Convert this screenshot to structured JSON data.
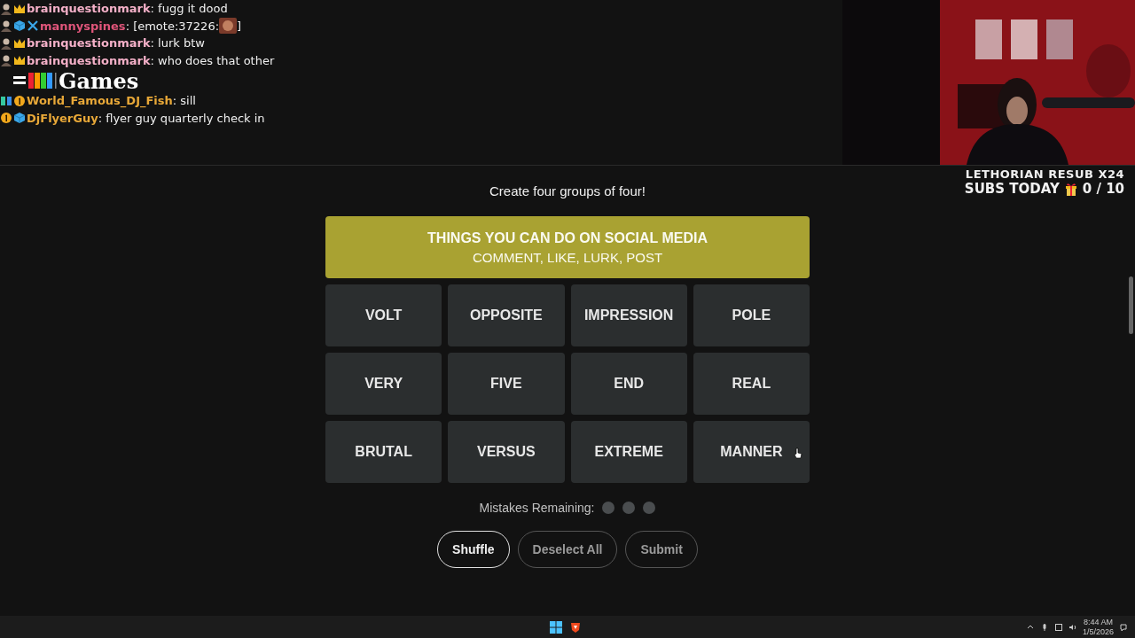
{
  "chat": [
    {
      "badges": [
        {
          "kind": "avatar"
        },
        {
          "kind": "crown"
        }
      ],
      "name": "brainquestionmark",
      "color": "#f4b0c8",
      "message": ": fugg it dood"
    },
    {
      "badges": [
        {
          "kind": "avatar"
        },
        {
          "kind": "cube"
        },
        {
          "kind": "sword"
        }
      ],
      "name": "mannyspines",
      "color": "#e0557a",
      "message": ": [emote:37226:",
      "emote": true,
      "tail": "]"
    },
    {
      "badges": [
        {
          "kind": "avatar"
        },
        {
          "kind": "crown"
        }
      ],
      "name": "brainquestionmark",
      "color": "#f4b0c8",
      "message": ": lurk btw"
    },
    {
      "badges": [
        {
          "kind": "avatar"
        },
        {
          "kind": "crown"
        }
      ],
      "name": "brainquestionmark",
      "color": "#f4b0c8",
      "message": ": who does that other"
    },
    {
      "badges": [
        {
          "kind": "pixel"
        },
        {
          "kind": "number"
        }
      ],
      "name": "World_Famous_DJ_Fish",
      "color": "#e8a838",
      "message": ": sill"
    },
    {
      "badges": [
        {
          "kind": "number"
        },
        {
          "kind": "cube"
        }
      ],
      "name": "DjFlyerGuy",
      "color": "#e8a838",
      "message": ": flyer guy quarterly check in"
    }
  ],
  "site_logo": "Games",
  "overlay": {
    "line_1": "LETHORIAN RESUB X24",
    "line_2": "SUBS TODAY",
    "count": "0 / 10"
  },
  "game": {
    "instruction": "Create four groups of four!",
    "solved": [
      {
        "title": "THINGS YOU CAN DO ON SOCIAL MEDIA",
        "words": "COMMENT, LIKE, LURK, POST",
        "color": "#a9a232"
      }
    ],
    "tiles": [
      {
        "word": "VOLT",
        "selected": false
      },
      {
        "word": "OPPOSITE",
        "selected": false
      },
      {
        "word": "IMPRESSION",
        "selected": false
      },
      {
        "word": "POLE",
        "selected": false
      },
      {
        "word": "VERY",
        "selected": false
      },
      {
        "word": "FIVE",
        "selected": false
      },
      {
        "word": "END",
        "selected": false
      },
      {
        "word": "REAL",
        "selected": false
      },
      {
        "word": "BRUTAL",
        "selected": false
      },
      {
        "word": "VERSUS",
        "selected": false
      },
      {
        "word": "EXTREME",
        "selected": false
      },
      {
        "word": "MANNER",
        "selected": false
      }
    ],
    "mistakes_label": "Mistakes Remaining:",
    "mistakes": [
      {
        "remaining": true
      },
      {
        "remaining": true
      },
      {
        "remaining": true
      }
    ],
    "buttons": [
      {
        "label": "Shuffle",
        "disabled": false
      },
      {
        "label": "Deselect All",
        "disabled": true
      },
      {
        "label": "Submit",
        "disabled": true
      }
    ]
  },
  "taskbar": {
    "time": "8:44 AM",
    "date": "1/5/2026"
  }
}
